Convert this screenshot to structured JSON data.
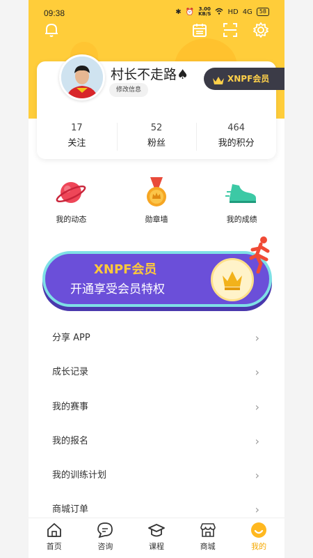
{
  "status_bar": {
    "time": "09:38",
    "speed_value": "3.00",
    "speed_unit": "KB/S",
    "network": "HD",
    "signal": "4G",
    "battery": "58"
  },
  "header_icons": {
    "bell": "bell-icon",
    "calendar": "calendar-icon",
    "scan": "scan-icon",
    "settings": "gear-icon"
  },
  "profile": {
    "name": "村长不走路♠",
    "edit_label": "修改信息",
    "vip_label": "XNPF会员"
  },
  "stats": [
    {
      "value": "17",
      "label": "关注"
    },
    {
      "value": "52",
      "label": "粉丝"
    },
    {
      "value": "464",
      "label": "我的积分"
    }
  ],
  "features": [
    {
      "label": "我的动态",
      "icon": "planet-icon"
    },
    {
      "label": "勋章墙",
      "icon": "medal-icon"
    },
    {
      "label": "我的成绩",
      "icon": "shoe-icon"
    }
  ],
  "banner": {
    "title": "XNPF会员",
    "subtitle": "开通享受会员特权"
  },
  "menu": [
    {
      "label": "分享 APP"
    },
    {
      "label": "成长记录"
    },
    {
      "label": "我的赛事"
    },
    {
      "label": "我的报名"
    },
    {
      "label": "我的训练计划"
    },
    {
      "label": "商城订单"
    }
  ],
  "tabs": [
    {
      "label": "首页",
      "icon": "home-icon"
    },
    {
      "label": "咨询",
      "icon": "chat-icon"
    },
    {
      "label": "课程",
      "icon": "graduation-cap-icon"
    },
    {
      "label": "商城",
      "icon": "store-icon"
    },
    {
      "label": "我的",
      "icon": "profile-icon"
    }
  ],
  "colors": {
    "brand_yellow": "#ffcd3a",
    "active_tab": "#f5a800",
    "banner_purple": "#6b4fd9"
  }
}
